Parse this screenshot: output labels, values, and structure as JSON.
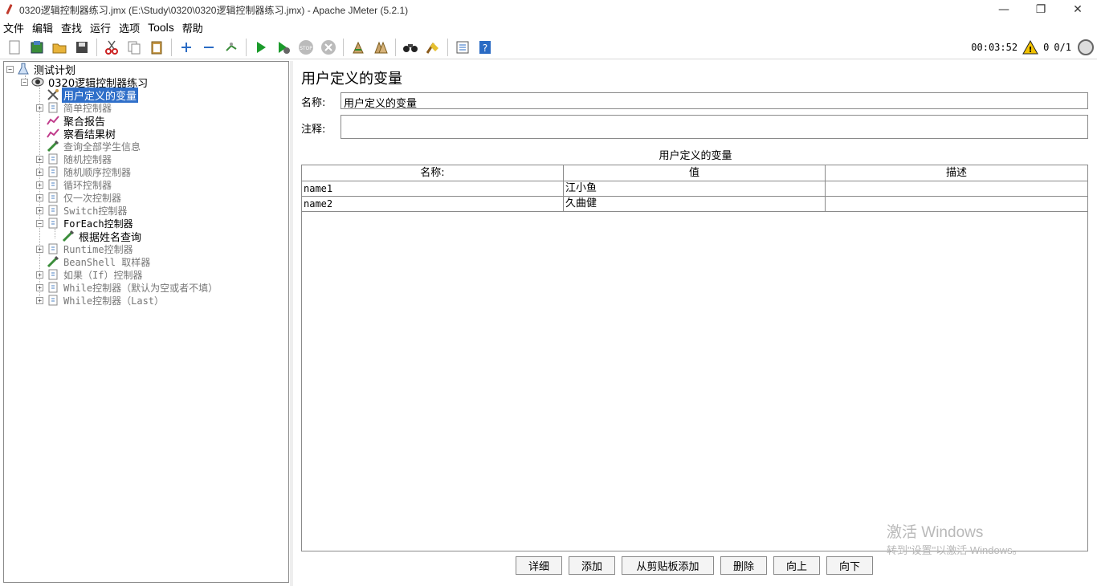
{
  "window": {
    "title": "0320逻辑控制器练习.jmx (E:\\Study\\0320\\0320逻辑控制器练习.jmx) - Apache JMeter (5.2.1)",
    "minimize": "—",
    "maximize": "❐",
    "close": "✕"
  },
  "menu": [
    "文件",
    "编辑",
    "查找",
    "运行",
    "选项",
    "Tools",
    "帮助"
  ],
  "toolbar": {
    "timer": "00:03:52",
    "warning_count": "0",
    "threads": "0/1"
  },
  "tree": {
    "items": [
      {
        "label": "测试计划",
        "icon": "test-plan-icon",
        "disabled": false
      },
      {
        "label": "0320逻辑控制器练习",
        "icon": "thread-group-icon",
        "disabled": false
      },
      {
        "label": "用户定义的变量",
        "icon": "config-icon",
        "disabled": false
      },
      {
        "label": "简单控制器",
        "icon": "controller-icon",
        "disabled": true
      },
      {
        "label": "聚合报告",
        "icon": "listener-icon",
        "disabled": false
      },
      {
        "label": "察看结果树",
        "icon": "listener-icon",
        "disabled": false
      },
      {
        "label": "查询全部学生信息",
        "icon": "sampler-icon",
        "disabled": true
      },
      {
        "label": "随机控制器",
        "icon": "controller-icon",
        "disabled": true
      },
      {
        "label": "随机顺序控制器",
        "icon": "controller-icon",
        "disabled": true
      },
      {
        "label": "循环控制器",
        "icon": "controller-icon",
        "disabled": true
      },
      {
        "label": "仅一次控制器",
        "icon": "controller-icon",
        "disabled": true
      },
      {
        "label": "Switch控制器",
        "icon": "controller-icon",
        "disabled": true
      },
      {
        "label": "ForEach控制器",
        "icon": "controller-icon",
        "disabled": false
      },
      {
        "label": "根据姓名查询",
        "icon": "sampler-icon",
        "disabled": false
      },
      {
        "label": "Runtime控制器",
        "icon": "controller-icon",
        "disabled": true
      },
      {
        "label": "BeanShell 取样器",
        "icon": "sampler-icon",
        "disabled": true
      },
      {
        "label": "如果（If）控制器",
        "icon": "controller-icon",
        "disabled": true
      },
      {
        "label": "While控制器（默认为空或者不填）",
        "icon": "controller-icon",
        "disabled": true
      },
      {
        "label": "While控制器（Last）",
        "icon": "controller-icon",
        "disabled": true
      }
    ]
  },
  "panel": {
    "title": "用户定义的变量",
    "name_label": "名称:",
    "name_value": "用户定义的变量",
    "comment_label": "注释:",
    "comment_value": "",
    "table_caption": "用户定义的变量",
    "columns": [
      "名称:",
      "值",
      "描述"
    ],
    "rows": [
      {
        "name": "name1",
        "value": "江小鱼",
        "desc": ""
      },
      {
        "name": "name2",
        "value": "久曲健",
        "desc": ""
      }
    ],
    "buttons": [
      "详细",
      "添加",
      "从剪贴板添加",
      "删除",
      "向上",
      "向下"
    ]
  },
  "watermark": {
    "line1": "激活 Windows",
    "line2": "转到\"设置\"以激活 Windows。"
  },
  "colors": {
    "selection": "#2f6fc9",
    "disabled_text": "#777777"
  }
}
